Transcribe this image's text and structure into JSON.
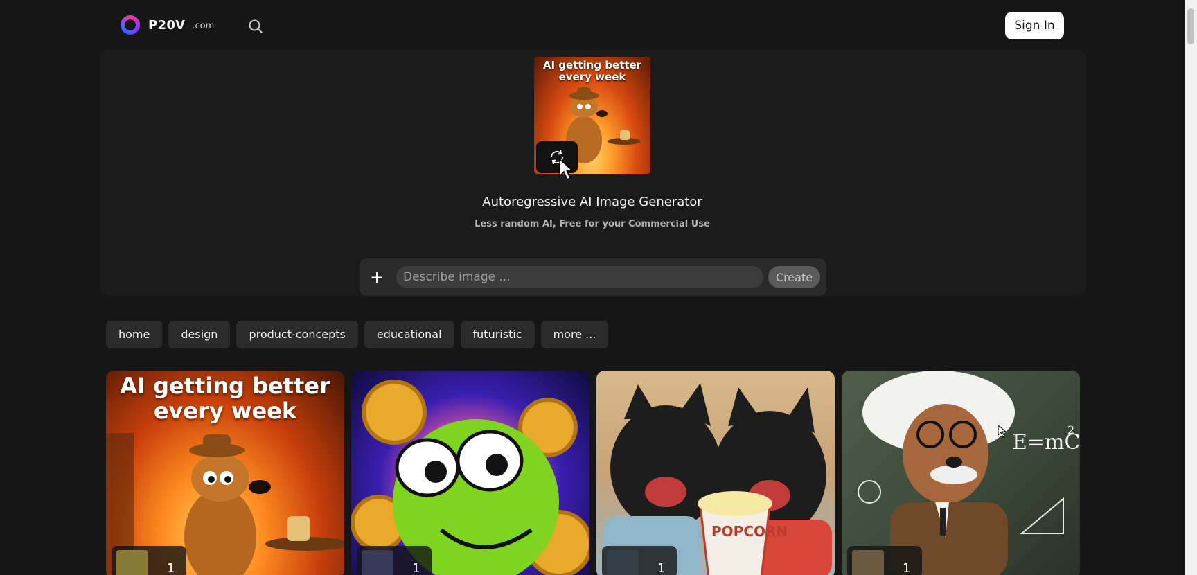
{
  "header": {
    "logo_name": "P20V",
    "logo_tld": ".com",
    "search_icon": "search-icon",
    "signin_label": "Sign In"
  },
  "hero": {
    "thumbnail_caption": "AI getting better every week",
    "refresh_icon": "refresh-icon",
    "title": "Autoregressive AI Image Generator",
    "subtitle": "Less random AI, Free for your Commercial Use",
    "prompt": {
      "plus_label": "+",
      "placeholder": "Describe image ...",
      "value": "",
      "create_label": "Create"
    }
  },
  "tags": [
    {
      "label": "home"
    },
    {
      "label": "design"
    },
    {
      "label": "product-concepts"
    },
    {
      "label": "educational"
    },
    {
      "label": "futuristic"
    },
    {
      "label": "more ..."
    }
  ],
  "gallery": [
    {
      "caption": "AI getting better every week",
      "count": "1"
    },
    {
      "caption": "",
      "count": "1"
    },
    {
      "caption": "",
      "text": "POPCORN",
      "count": "1"
    },
    {
      "caption": "",
      "board": [
        "E=mC",
        "2"
      ],
      "count": "1"
    }
  ],
  "colors": {
    "background": "#161616",
    "panel": "#1b1b1b",
    "tag_bg": "#2b2b2b",
    "signin_bg": "#ffffff"
  }
}
